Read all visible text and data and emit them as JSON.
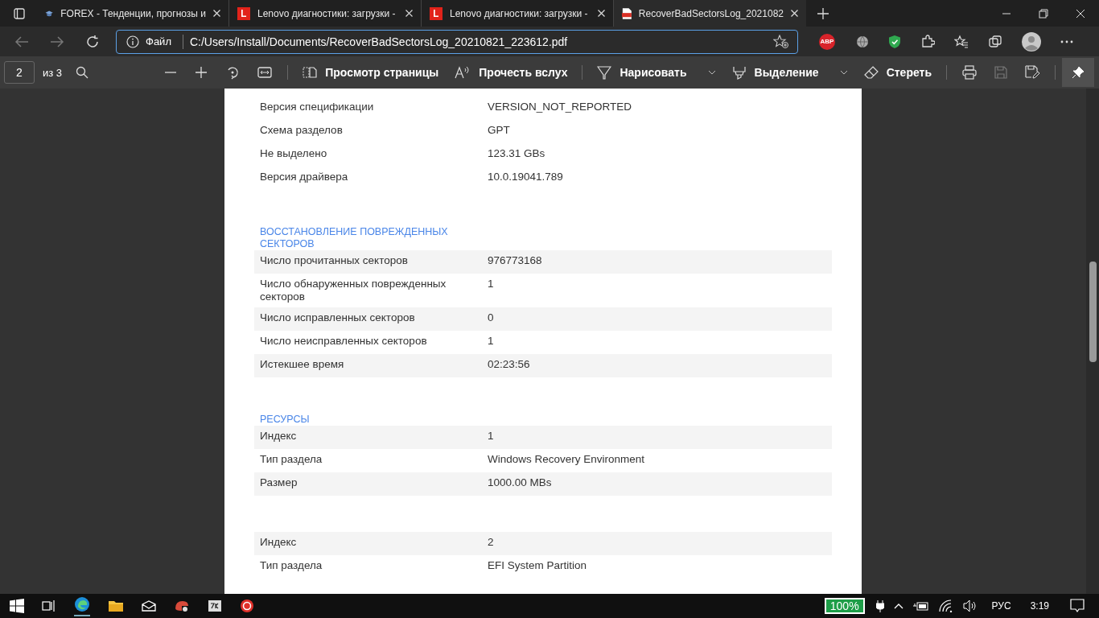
{
  "tabs": [
    {
      "title": "FOREX - Тенденции, прогнозы и",
      "kind": "cap",
      "selected": false
    },
    {
      "title": "Lenovo диагностики: загрузки -",
      "kind": "lenovo",
      "selected": false
    },
    {
      "title": "Lenovo диагностики: загрузки -",
      "kind": "lenovo",
      "selected": false
    },
    {
      "title": "RecoverBadSectorsLog_2021082",
      "kind": "pdf",
      "selected": true
    }
  ],
  "address": {
    "scheme_label": "Файл",
    "url": "C:/Users/Install/Documents/RecoverBadSectorsLog_20210821_223612.pdf"
  },
  "extensions": [
    {
      "kind": "abp",
      "label": "ABP"
    },
    {
      "kind": "globe"
    },
    {
      "kind": "shield"
    }
  ],
  "pdf_toolbar": {
    "page": "2",
    "page_count": "из 3",
    "buttons": [
      {
        "kind": "view",
        "label": "Просмотр страницы"
      },
      {
        "kind": "read",
        "label": "Прочесть вслух"
      },
      {
        "kind": "draw",
        "label": "Нарисовать",
        "dropdown": true
      },
      {
        "kind": "highlight",
        "label": "Выделение",
        "dropdown": true
      },
      {
        "kind": "erase",
        "label": "Стереть"
      }
    ]
  },
  "sections": [
    {
      "kind": "plain",
      "rows": [
        {
          "label": "Версия спецификации",
          "value": "VERSION_NOT_REPORTED"
        },
        {
          "label": "Схема разделов",
          "value": "GPT"
        },
        {
          "label": "Не выделено",
          "value": "123.31 GBs"
        },
        {
          "label": "Версия драйвера",
          "value": "10.0.19041.789"
        }
      ]
    },
    {
      "heading": "ВОССТАНОВЛЕНИЕ ПОВРЕЖДЕННЫХ СЕКТОРОВ",
      "kind": "striped",
      "rows": [
        {
          "label": "Число прочитанных секторов",
          "value": "976773168"
        },
        {
          "label": "Число обнаруженных поврежденных секторов",
          "value": "1"
        },
        {
          "label": "Число исправленных секторов",
          "value": "0"
        },
        {
          "label": "Число неисправленных секторов",
          "value": "1"
        },
        {
          "label": "Истекшее время",
          "value": "02:23:56"
        }
      ]
    },
    {
      "heading": "РЕСУРСЫ",
      "kind": "striped",
      "rows": [
        {
          "label": "Индекс",
          "value": "1"
        },
        {
          "label": "Тип раздела",
          "value": "Windows Recovery Environment"
        },
        {
          "label": "Размер",
          "value": "1000.00 MBs"
        }
      ]
    },
    {
      "kind": "striped",
      "rows": [
        {
          "label": "Индекс",
          "value": "2"
        },
        {
          "label": "Тип раздела",
          "value": "EFI System Partition"
        }
      ]
    }
  ],
  "tray": {
    "battery": "100%",
    "language": "РУС",
    "time": "3:19"
  }
}
